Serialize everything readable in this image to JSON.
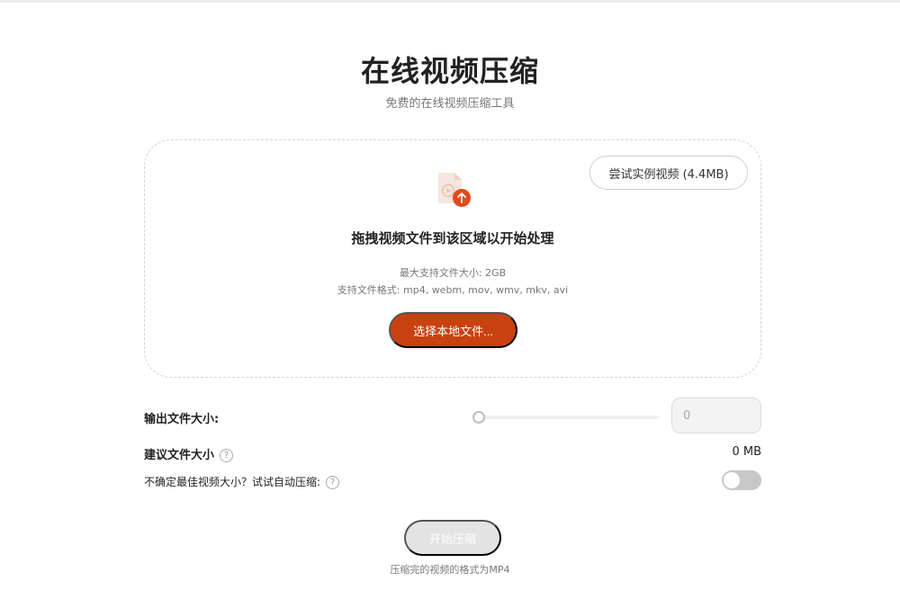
{
  "header": {
    "title": "在线视频压缩",
    "subtitle": "免费的在线视频压缩工具"
  },
  "dropzone": {
    "sample_button": "尝试实例视频 (4.4MB)",
    "drop_text": "拖拽视频文件到该区域以开始处理",
    "max_size": "最大支持文件大小: 2GB",
    "formats": "支持文件格式: mp4, webm, mov, wmv, mkv, avi",
    "choose_button": "选择本地文件...",
    "icon": "video-file-upload-icon"
  },
  "settings": {
    "output_size_label": "输出文件大小:",
    "output_size_value": "0",
    "slider_value": 0,
    "suggested_label": "建议文件大小",
    "suggested_value": "0 MB",
    "auto_label": "不确定最佳视频大小？试试自动压缩:",
    "auto_enabled": false,
    "help_icon": "question-circle-icon"
  },
  "actions": {
    "start_button": "开始压缩",
    "output_note": "压缩完的视频的格式为MP4"
  },
  "colors": {
    "accent": "#c9410f",
    "upload_badge": "#e24a1a",
    "disabled": "#e3e3e3"
  }
}
